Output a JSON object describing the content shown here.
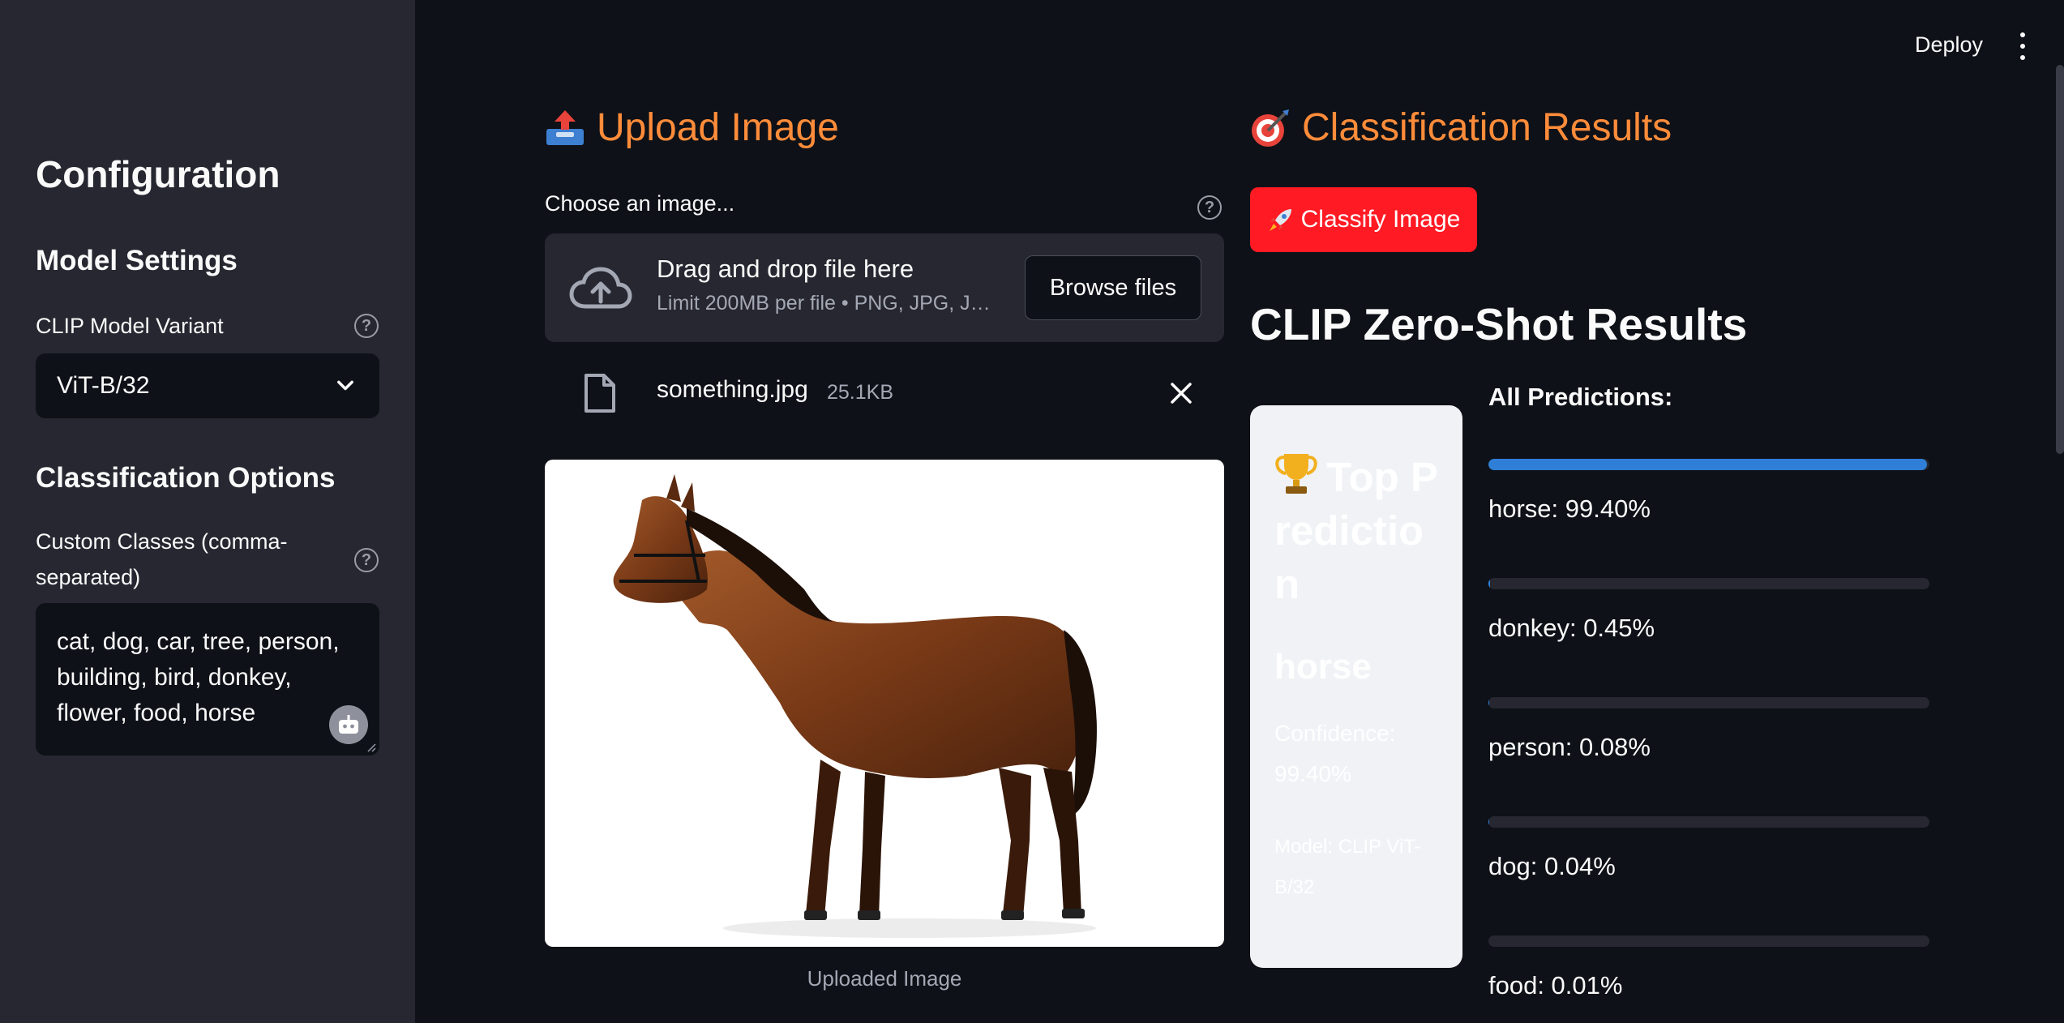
{
  "top_bar": {
    "deploy_label": "Deploy"
  },
  "sidebar": {
    "title": "Configuration",
    "model_settings_header": "Model Settings",
    "model_variant_label": "CLIP Model Variant",
    "model_variant_value": "ViT-B/32",
    "classification_header": "Classification Options",
    "custom_classes_label": "Custom Classes (comma-separated)",
    "custom_classes_value": "cat, dog, car, tree, person, building, bird, donkey, flower, food, horse"
  },
  "upload": {
    "header": "Upload Image",
    "choose_label": "Choose an image...",
    "drop_title": "Drag and drop file here",
    "drop_limit": "Limit 200MB per file • PNG, JPG, J…",
    "browse_label": "Browse files",
    "file_name": "something.jpg",
    "file_size": "25.1KB",
    "image_caption": "Uploaded Image"
  },
  "results": {
    "header": "Classification Results",
    "classify_label": "Classify Image",
    "clip_title": "CLIP Zero-Shot Results",
    "top_card": {
      "heading": "Top Prediction",
      "class": "horse",
      "confidence": "Confidence: 99.40%",
      "model": "Model: CLIP ViT-B/32"
    },
    "all_predictions_label": "All Predictions:",
    "predictions": [
      {
        "label": "horse: 99.40%",
        "fraction": 0.994
      },
      {
        "label": "donkey: 0.45%",
        "fraction": 0.0045
      },
      {
        "label": "person: 0.08%",
        "fraction": 0.0008
      },
      {
        "label": "dog: 0.04%",
        "fraction": 0.0004
      },
      {
        "label": "food: 0.01%",
        "fraction": 0.0001
      }
    ]
  },
  "colors": {
    "accent_orange": "#ff8c3a",
    "classify_red": "#ff1a24",
    "progress_blue": "#2f7fd8"
  }
}
